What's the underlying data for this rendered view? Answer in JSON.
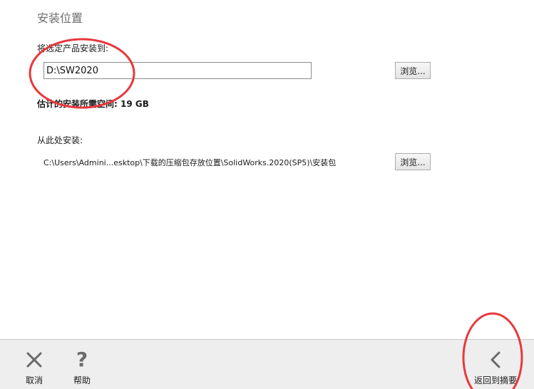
{
  "section": {
    "title": "安装位置"
  },
  "install_location": {
    "label": "将选定产品安装到:",
    "path_value": "D:\\SW2020",
    "browse_label": "浏览..."
  },
  "space": {
    "text": "估计的安装所需空间: 19 GB"
  },
  "install_source": {
    "label": "从此处安装:",
    "path_text": "C:\\Users\\Admini...esktop\\下载的压缩包存放位置\\SolidWorks.2020(SP5)\\安装包",
    "browse_label": "浏览..."
  },
  "footer": {
    "cancel_label": "取消",
    "help_label": "帮助",
    "back_label": "返回到摘要"
  },
  "icons": {
    "cancel": "close-icon",
    "help": "question-icon",
    "back": "chevron-left-icon"
  },
  "colors": {
    "annotation_red": "#e8383d",
    "footer_bg": "#eeeeee",
    "icon_gray": "#6a6a6a"
  }
}
